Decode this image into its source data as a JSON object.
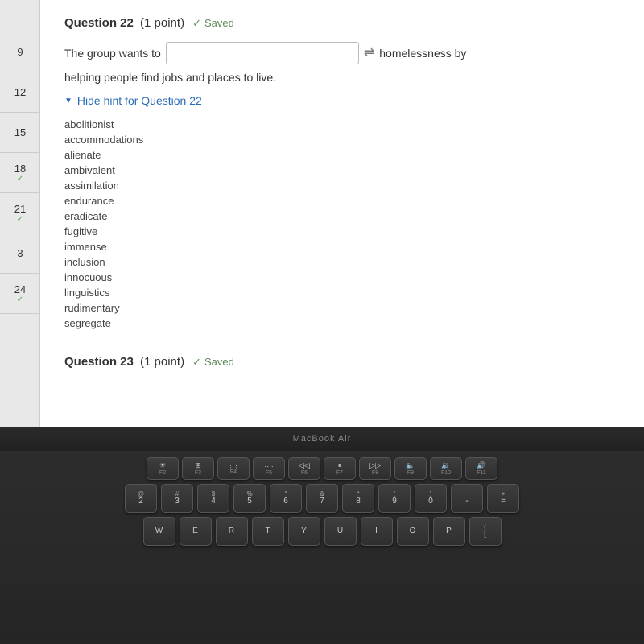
{
  "question22": {
    "title": "Question 22",
    "points": "(1 point)",
    "saved_label": "Saved",
    "body_before_input": "The group wants to",
    "body_after_input": "homelessness by",
    "body_line2": "helping people find jobs and places to live.",
    "input_value": "",
    "input_placeholder": "",
    "hint_label": "Hide hint for Question 22",
    "words": [
      "abolitionist",
      "accommodations",
      "alienate",
      "ambivalent",
      "assimilation",
      "endurance",
      "eradicate",
      "fugitive",
      "immense",
      "inclusion",
      "innocuous",
      "linguistics",
      "rudimentary",
      "segregate"
    ]
  },
  "question23": {
    "title": "Question 23",
    "points": "(1 point)",
    "saved_label": "Saved"
  },
  "sidebar": {
    "items": [
      {
        "number": "9",
        "check": ""
      },
      {
        "number": "12",
        "check": ""
      },
      {
        "number": "15",
        "check": ""
      },
      {
        "number": "18",
        "check": "✓"
      },
      {
        "number": "21",
        "check": "✓"
      },
      {
        "number": "3",
        "check": ""
      },
      {
        "number": "24",
        "check": "✓"
      }
    ]
  },
  "bezel": {
    "brand": "MacBook Air"
  },
  "keyboard": {
    "fn_row": [
      {
        "label": "☀",
        "sub": "F2"
      },
      {
        "label": "⊞",
        "sub": "F3"
      },
      {
        "label": "⋮⋮⋮",
        "sub": "F4"
      },
      {
        "label": "···",
        "sub": "F5"
      },
      {
        "label": "◁◁",
        "sub": "F6"
      },
      {
        "label": "▷‖",
        "sub": "F7"
      },
      {
        "label": "▷▷",
        "sub": "F8"
      },
      {
        "label": "◁",
        "sub": "F9"
      },
      {
        "label": "▷",
        "sub": "F10"
      },
      {
        "label": "◁|",
        "sub": "F11"
      }
    ],
    "num_row": [
      {
        "top": "@",
        "bottom": "2"
      },
      {
        "top": "#",
        "bottom": "3"
      },
      {
        "top": "$",
        "bottom": "4"
      },
      {
        "top": "%",
        "bottom": "5"
      },
      {
        "top": "^",
        "bottom": "6"
      },
      {
        "top": "&",
        "bottom": "7"
      },
      {
        "top": "*",
        "bottom": "8"
      },
      {
        "top": "(",
        "bottom": "9"
      },
      {
        "top": ")",
        "bottom": "0"
      },
      {
        "top": "_",
        "bottom": "-"
      },
      {
        "top": "+",
        "bottom": "="
      }
    ],
    "qwerty_row": [
      "W",
      "E",
      "R",
      "T",
      "Y",
      "U",
      "I",
      "O",
      "P",
      "{",
      "["
    ]
  }
}
